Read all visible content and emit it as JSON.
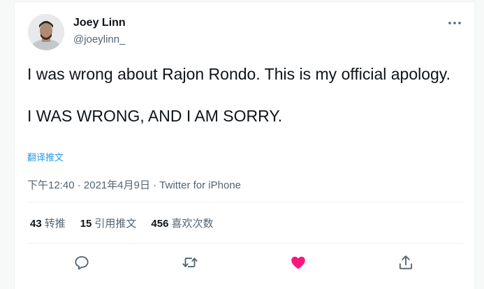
{
  "author": {
    "display_name": "Joey Linn",
    "handle": "@joeylinn_"
  },
  "tweet": {
    "paragraphs": [
      "I was wrong about Rajon Rondo. This is my official apology.",
      "I WAS WRONG, AND I AM SORRY."
    ],
    "translate_label": "翻译推文",
    "time": "下午12:40",
    "separator": "·",
    "date": "2021年4月9日",
    "source": "Twitter for iPhone"
  },
  "stats": {
    "retweets": {
      "count": "43",
      "label": "转推"
    },
    "quotes": {
      "count": "15",
      "label": "引用推文"
    },
    "likes": {
      "count": "456",
      "label": "喜欢次数"
    }
  },
  "actions": {
    "reply_icon": "reply-icon",
    "retweet_icon": "retweet-icon",
    "like_icon": "heart-filled-icon",
    "share_icon": "share-icon"
  },
  "colors": {
    "text": "#0f1419",
    "secondary": "#536471",
    "link": "#1d9bf0",
    "like": "#f91880",
    "border": "#eff3f4"
  }
}
